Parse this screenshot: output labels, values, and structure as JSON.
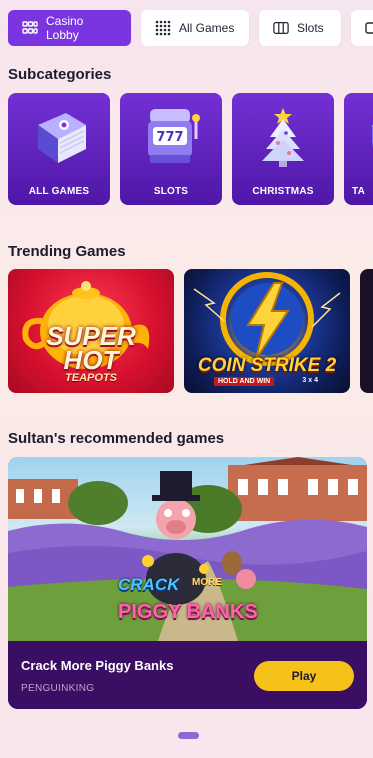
{
  "tabs": [
    {
      "label": "Casino Lobby",
      "icon": "grid-icon",
      "active": true
    },
    {
      "label": "All Games",
      "icon": "dots-grid-icon",
      "active": false
    },
    {
      "label": "Slots",
      "icon": "slot-reels-icon",
      "active": false
    },
    {
      "label": "",
      "icon": "tab-icon",
      "active": false
    }
  ],
  "sections": {
    "subcategories": "Subcategories",
    "trending": "Trending Games",
    "recommended": "Sultan's recommended games"
  },
  "subcategories": [
    {
      "label": "ALL GAMES",
      "icon": "book-icon"
    },
    {
      "label": "SLOTS",
      "icon": "slot-machine-icon"
    },
    {
      "label": "CHRISTMAS",
      "icon": "christmas-tree-icon"
    },
    {
      "label": "TA",
      "icon": "table-icon"
    }
  ],
  "trending": [
    {
      "logo_line1": "SUPER",
      "logo_line2": "HOT",
      "logo_line3": "TEAPOTS"
    },
    {
      "logo_line1": "COIN STRIKE 2",
      "logo_line2": "HOLD AND WIN",
      "logo_line3": "3 x 4"
    },
    {}
  ],
  "recommended": {
    "logo_line1": "CRACK",
    "logo_line2": "MORE",
    "logo_line3": "PIGGY BANKS",
    "game_name": "Crack More Piggy Banks",
    "provider": "PENGUINKING",
    "play_label": "Play"
  },
  "colors": {
    "accent": "#7b35e0",
    "card_purple": "#5a1cb4",
    "play_yellow": "#f6c21a",
    "rec_bar": "#3a0e63"
  }
}
